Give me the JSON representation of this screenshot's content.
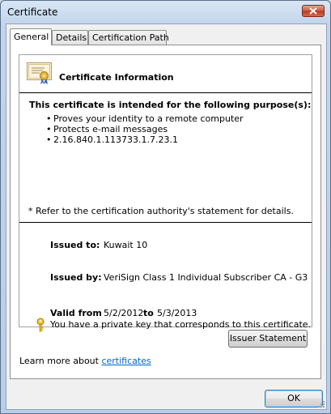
{
  "window": {
    "title": "Certificate"
  },
  "tabs": [
    {
      "label": "General",
      "active": true
    },
    {
      "label": "Details",
      "active": false
    },
    {
      "label": "Certification Path",
      "active": false
    }
  ],
  "cert": {
    "info_title": "Certificate Information",
    "purpose_heading": "This certificate is intended for the following purpose(s):",
    "purposes": [
      "Proves your identity to a remote computer",
      "Protects e-mail messages",
      "2.16.840.1.113733.1.7.23.1"
    ],
    "bullet": "•",
    "refer_note": "* Refer to the certification authority's statement for details.",
    "issued_to_label": "Issued to:",
    "issued_to_value": "Kuwait 10",
    "issued_by_label": "Issued by:",
    "issued_by_value": "VeriSign Class 1 Individual Subscriber CA - G3",
    "valid_from_label": "Valid from",
    "valid_from_value": "5/2/2012",
    "valid_to_label": "to",
    "valid_to_value": "5/3/2013",
    "private_key_note": "You have a private key that corresponds to this certificate."
  },
  "buttons": {
    "issuer_statement": "Issuer Statement",
    "ok": "OK"
  },
  "learn_more": {
    "prefix": "Learn more about",
    "link": "certificates"
  },
  "icons": {
    "certificate": "certificate-icon",
    "key": "key-icon",
    "close": "close-icon"
  },
  "colors": {
    "link": "#0066cc",
    "close_button": "#c95b44",
    "key": "#d9a800"
  }
}
